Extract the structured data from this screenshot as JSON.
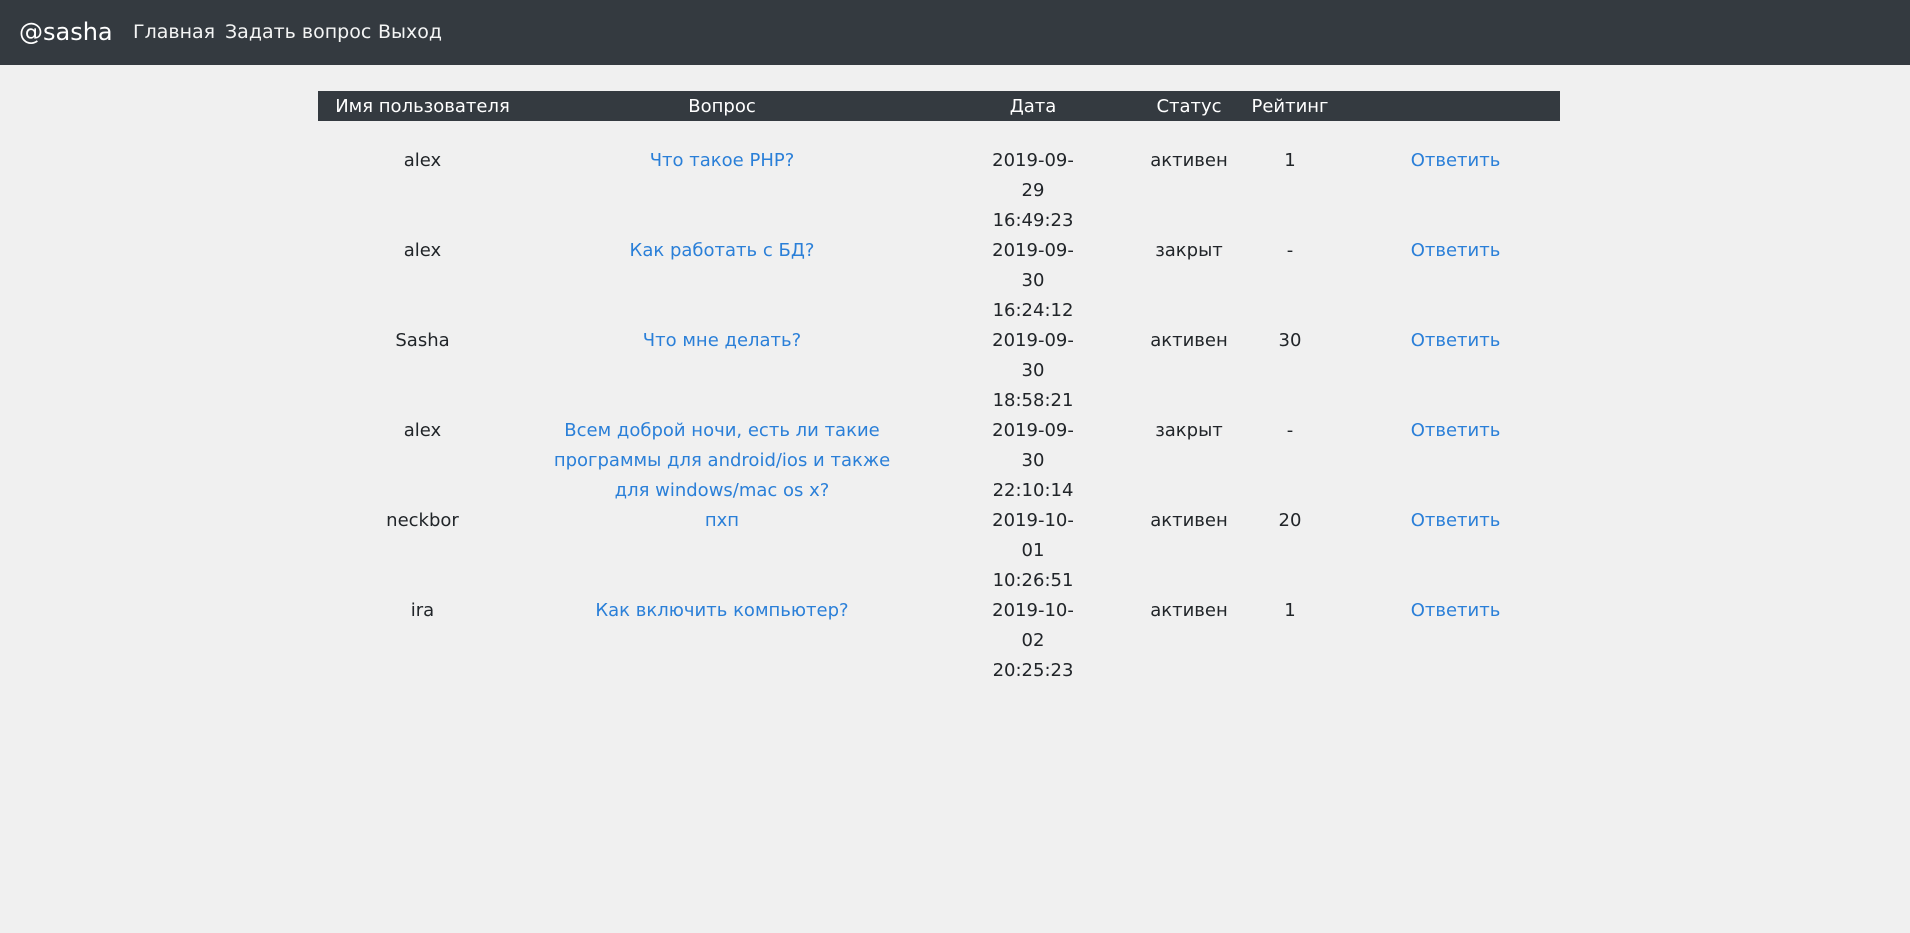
{
  "navbar": {
    "brand": "@sasha",
    "links": [
      "Главная",
      "Задать вопрос",
      "Выход"
    ]
  },
  "table": {
    "headers": [
      "Имя пользователя",
      "Вопрос",
      "Дата",
      "Статус",
      "Рейтинг",
      ""
    ],
    "rows": [
      {
        "user": "alex",
        "question": "Что такое PHP?",
        "date": "2019-09-29 16:49:23",
        "status": "активен",
        "rating": "1",
        "action": "Ответить"
      },
      {
        "user": "alex",
        "question": "Как работать с БД?",
        "date": "2019-09-30 16:24:12",
        "status": "закрыт",
        "rating": "-",
        "action": "Ответить"
      },
      {
        "user": "Sasha",
        "question": "Что мне делать?",
        "date": "2019-09-30 18:58:21",
        "status": "активен",
        "rating": "30",
        "action": "Ответить"
      },
      {
        "user": "alex",
        "question": "Всем доброй ночи, есть ли такие программы для android/ios и также для windows/mac os x?",
        "date": "2019-09-30 22:10:14",
        "status": "закрыт",
        "rating": "-",
        "action": "Ответить"
      },
      {
        "user": "neckbor",
        "question": "пхп",
        "date": "2019-10-01 10:26:51",
        "status": "активен",
        "rating": "20",
        "action": "Ответить"
      },
      {
        "user": "ira",
        "question": "Как включить компьютер?",
        "date": "2019-10-02 20:25:23",
        "status": "активен",
        "rating": "1",
        "action": "Ответить"
      }
    ]
  }
}
